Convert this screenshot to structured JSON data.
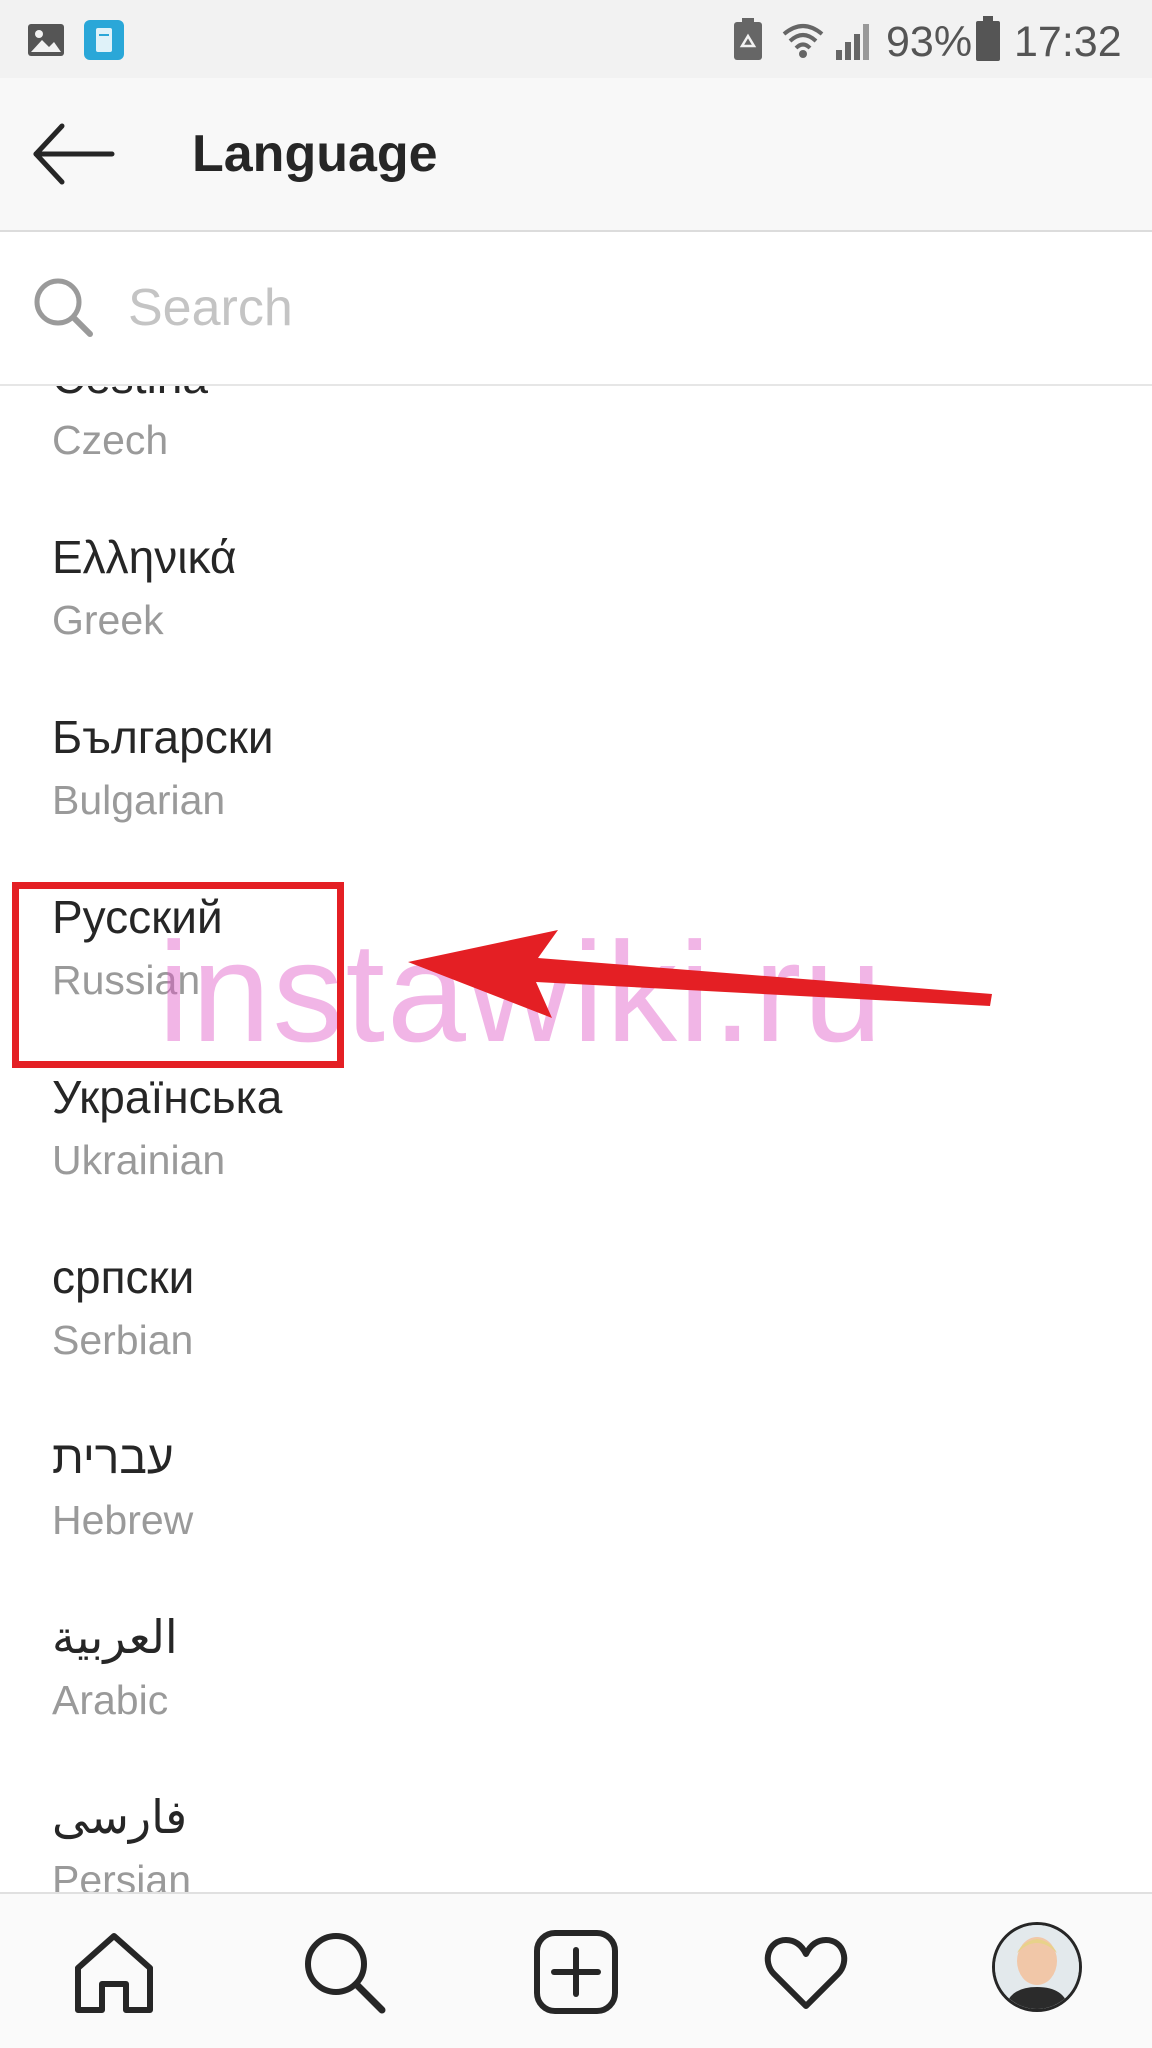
{
  "status_bar": {
    "battery_percent": "93%",
    "time": "17:32",
    "icons": [
      "gallery-icon",
      "app-notification-icon",
      "recycle-icon",
      "wifi-icon",
      "signal-icon",
      "battery-icon"
    ]
  },
  "header": {
    "title": "Language",
    "back_icon": "back-arrow-icon"
  },
  "search": {
    "placeholder": "Search",
    "value": "",
    "icon": "search-icon"
  },
  "languages": [
    {
      "native": "Cestina",
      "english": "Czech"
    },
    {
      "native": "Ελληνικά",
      "english": "Greek"
    },
    {
      "native": "Български",
      "english": "Bulgarian"
    },
    {
      "native": "Русский",
      "english": "Russian"
    },
    {
      "native": "Українська",
      "english": "Ukrainian"
    },
    {
      "native": "српски",
      "english": "Serbian"
    },
    {
      "native": "עברית",
      "english": "Hebrew"
    },
    {
      "native": "العربية",
      "english": "Arabic"
    },
    {
      "native": "فارسی",
      "english": "Persian"
    }
  ],
  "annotation": {
    "watermark": "instawiki.ru",
    "highlight_color": "#e41f24"
  },
  "bottom_nav": {
    "items": [
      "home-icon",
      "search-icon",
      "add-post-icon",
      "heart-icon",
      "profile-avatar"
    ]
  },
  "colors": {
    "primary_text": "#262626",
    "secondary_text": "#9a9a9a",
    "placeholder": "#c4c4c4",
    "status_bar_bg": "#f2f2f2",
    "header_bg": "#f8f8f8"
  }
}
